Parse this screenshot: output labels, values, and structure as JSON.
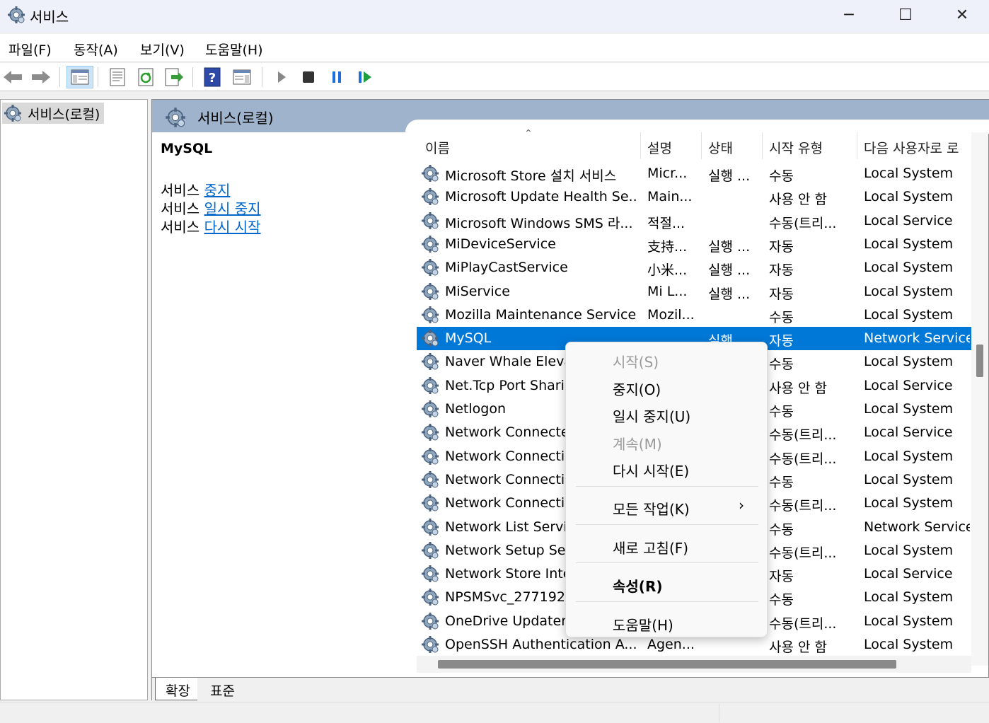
{
  "window": {
    "title": "서비스",
    "minimize_icon": "─",
    "maximize_icon": "☐",
    "close_icon": "✕"
  },
  "menu": [
    "파일(F)",
    "동작(A)",
    "보기(V)",
    "도움말(H)"
  ],
  "tree": {
    "root": "서비스(로컬)"
  },
  "pane_header": "서비스(로컬)",
  "details": {
    "name": "MySQL",
    "actions": [
      {
        "prefix": "서비스 ",
        "link": "중지"
      },
      {
        "prefix": "서비스 ",
        "link": "일시 중지"
      },
      {
        "prefix": "서비스 ",
        "link": "다시 시작"
      }
    ]
  },
  "columns": {
    "name": "이름",
    "desc": "설명",
    "status": "상태",
    "startup": "시작 유형",
    "logon": "다음 사용자로 로"
  },
  "rows": [
    {
      "name": "Microsoft Store 설치 서비스",
      "desc": "Micr...",
      "status": "실행 ...",
      "startup": "수동",
      "logon": "Local System"
    },
    {
      "name": "Microsoft Update Health Se...",
      "desc": "Main...",
      "status": "",
      "startup": "사용 안 함",
      "logon": "Local System"
    },
    {
      "name": "Microsoft Windows SMS 라...",
      "desc": "적절...",
      "status": "",
      "startup": "수동(트리...",
      "logon": "Local Service"
    },
    {
      "name": "MiDeviceService",
      "desc": "支持...",
      "status": "실행 ...",
      "startup": "자동",
      "logon": "Local System"
    },
    {
      "name": "MiPlayCastService",
      "desc": "小米...",
      "status": "실행 ...",
      "startup": "자동",
      "logon": "Local System"
    },
    {
      "name": "MiService",
      "desc": "Mi L...",
      "status": "실행 ...",
      "startup": "자동",
      "logon": "Local System"
    },
    {
      "name": "Mozilla Maintenance Service",
      "desc": "Mozil...",
      "status": "",
      "startup": "수동",
      "logon": "Local System"
    },
    {
      "name": "MySQL",
      "desc": "",
      "status": "실행",
      "startup": "자동",
      "logon": "Network Service"
    },
    {
      "name": "Naver Whale Eleva",
      "desc": "",
      "status": "",
      "startup": "수동",
      "logon": "Local System"
    },
    {
      "name": "Net.Tcp Port Sharir",
      "desc": "",
      "status": "",
      "startup": "사용 안 함",
      "logon": "Local Service"
    },
    {
      "name": "Netlogon",
      "desc": "",
      "status": "",
      "startup": "수동",
      "logon": "Local System"
    },
    {
      "name": "Network Connecte",
      "desc": "",
      "status": "",
      "startup": "수동(트리...",
      "logon": "Local Service"
    },
    {
      "name": "Network Connectic",
      "desc": "",
      "status": "",
      "startup": "수동(트리...",
      "logon": "Local System"
    },
    {
      "name": "Network Connectic",
      "desc": "",
      "status": "",
      "startup": "수동",
      "logon": "Local System"
    },
    {
      "name": "Network Connectiv",
      "desc": "",
      "status": "",
      "startup": "수동(트리...",
      "logon": "Local System"
    },
    {
      "name": "Network List Servic",
      "desc": "",
      "status": "",
      "startup": "수동",
      "logon": "Network Service"
    },
    {
      "name": "Network Setup Ser",
      "desc": "",
      "status": "",
      "startup": "수동(트리...",
      "logon": "Local System"
    },
    {
      "name": "Network Store Inte",
      "desc": "",
      "status": "",
      "startup": "자동",
      "logon": "Local Service"
    },
    {
      "name": "NPSMSvc_2771922",
      "desc": "",
      "status": "",
      "startup": "수동",
      "logon": "Local System"
    },
    {
      "name": "OneDrive Updater",
      "desc": "",
      "status": "",
      "startup": "수동(트리...",
      "logon": "Local System"
    },
    {
      "name": "OpenSSH Authentication A...",
      "desc": "Agen...",
      "status": "",
      "startup": "사용 안 함",
      "logon": "Local System"
    }
  ],
  "context_menu": {
    "start": "시작(S)",
    "stop": "중지(O)",
    "pause": "일시 중지(U)",
    "resume": "계속(M)",
    "restart": "다시 시작(E)",
    "all_tasks": "모든 작업(K)",
    "refresh": "새로 고침(F)",
    "properties": "속성(R)",
    "help": "도움말(H)",
    "submenu_arrow": "›"
  },
  "tabs": [
    "확장",
    "표준"
  ],
  "colors": {
    "selection": "#0078d7",
    "link": "#0066cc",
    "header_band": "#9fb4cc"
  },
  "icons": {
    "toolbar": [
      "back-icon",
      "forward-icon",
      "show-console-tree-icon",
      "properties-icon",
      "refresh-icon",
      "export-list-icon",
      "help-icon",
      "show-action-pane-icon",
      "start-service-icon",
      "stop-service-icon",
      "pause-service-icon",
      "restart-service-icon"
    ]
  }
}
